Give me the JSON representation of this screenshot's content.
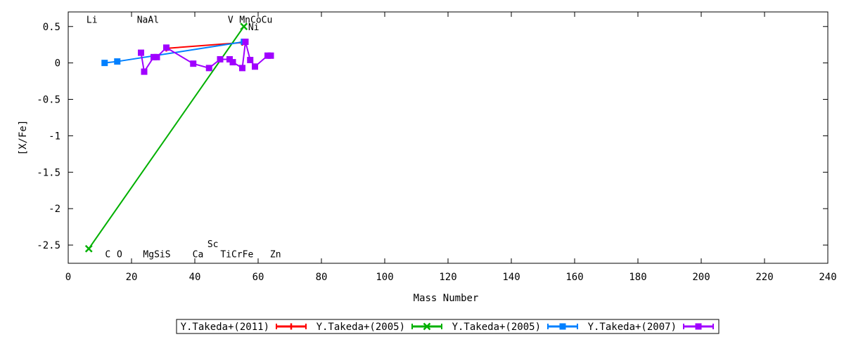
{
  "chart_data": {
    "type": "line",
    "xlabel": "Mass Number",
    "ylabel": "[X/Fe]",
    "xlim": [
      0,
      240
    ],
    "ylim": [
      -2.75,
      0.7
    ],
    "xticks": [
      0,
      20,
      40,
      60,
      80,
      100,
      120,
      140,
      160,
      180,
      200,
      220,
      240
    ],
    "yticks": [
      0.5,
      0,
      -0.5,
      -1,
      -1.5,
      -2,
      -2.5
    ],
    "xtick_labels": [
      "0",
      "20",
      "40",
      "60",
      "80",
      "100",
      "120",
      "140",
      "160",
      "180",
      "200",
      "220",
      "240"
    ],
    "ytick_labels": [
      "0.5",
      "0",
      "-0.5",
      "-1",
      "-1.5",
      "-2",
      "-2.5"
    ],
    "grid": false,
    "legend_position": "bottom-center",
    "element_labels": [
      {
        "text": "Li",
        "x": 7.5,
        "y": 0.6
      },
      {
        "text": "NaAl",
        "x": 25.2,
        "y": 0.6
      },
      {
        "text": "V",
        "x": 51.3,
        "y": 0.6
      },
      {
        "text": "MnCoCu",
        "x": 59.3,
        "y": 0.6
      },
      {
        "text": "Ni",
        "x": 58.6,
        "y": 0.5
      },
      {
        "text": "Sc",
        "x": 45.7,
        "y": -2.48
      },
      {
        "text": "C",
        "x": 12.5,
        "y": -2.62
      },
      {
        "text": "O",
        "x": 16.2,
        "y": -2.62
      },
      {
        "text": "MgSiS",
        "x": 28,
        "y": -2.62
      },
      {
        "text": "Ca",
        "x": 41,
        "y": -2.62
      },
      {
        "text": "TiCrFe",
        "x": 53.3,
        "y": -2.62
      },
      {
        "text": "Zn",
        "x": 65.5,
        "y": -2.62
      }
    ],
    "series": [
      {
        "name": "Y.Takeda+(2011)",
        "color": "#ff0000",
        "marker": "plus",
        "x": [
          31,
          55
        ],
        "y": [
          0.2,
          0.28
        ]
      },
      {
        "name": "Y.Takeda+(2005)",
        "color": "#00b000",
        "marker": "cross",
        "x": [
          6.5,
          55.5
        ],
        "y": [
          -2.55,
          0.5
        ]
      },
      {
        "name": "Y.Takeda+(2005)",
        "color": "#0080ff",
        "marker": "square",
        "x": [
          11.5,
          15.5,
          55.5
        ],
        "y": [
          0,
          0.02,
          0.29
        ]
      },
      {
        "name": "Y.Takeda+(2007)",
        "color": "#a000ff",
        "marker": "square",
        "x": [
          23,
          24,
          27,
          28,
          31,
          39.5,
          44.5,
          48,
          51,
          52,
          55,
          56,
          57.5,
          59,
          63,
          64
        ],
        "y": [
          0.14,
          -0.12,
          0.08,
          0.08,
          0.21,
          -0.01,
          -0.07,
          0.05,
          0.05,
          0.01,
          -0.07,
          0.29,
          0.04,
          -0.05,
          0.1,
          0.1
        ]
      }
    ]
  }
}
